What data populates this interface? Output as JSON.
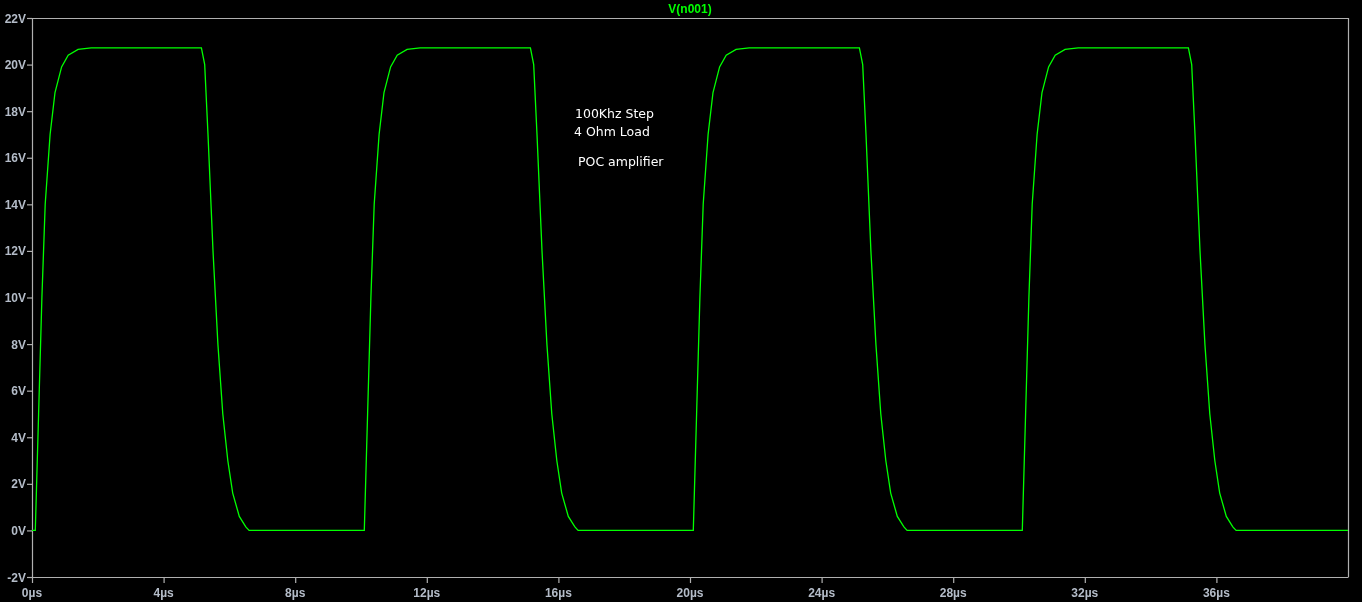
{
  "plot": {
    "chart_data": {
      "type": "line",
      "x": [
        0,
        0.1,
        0.2,
        0.3,
        0.4,
        0.55,
        0.7,
        0.9,
        1.1,
        1.4,
        1.8,
        5.15,
        5.25,
        5.35,
        5.5,
        5.65,
        5.8,
        5.95,
        6.1,
        6.3,
        6.5,
        6.6,
        10.1,
        10.2,
        10.3,
        10.4,
        10.55,
        10.7,
        10.9,
        11.1,
        11.4,
        11.8,
        15.15,
        15.25,
        15.35,
        15.5,
        15.65,
        15.8,
        15.95,
        16.1,
        16.3,
        16.5,
        16.6,
        20.1,
        20.2,
        20.3,
        20.4,
        20.55,
        20.7,
        20.9,
        21.1,
        21.4,
        21.8,
        25.15,
        25.25,
        25.35,
        25.5,
        25.65,
        25.8,
        25.95,
        26.1,
        26.3,
        26.5,
        26.6,
        30.1,
        30.2,
        30.3,
        30.4,
        30.55,
        30.7,
        30.9,
        31.1,
        31.4,
        31.8,
        35.15,
        35.25,
        35.35,
        35.5,
        35.65,
        35.8,
        35.95,
        36.1,
        36.3,
        36.5,
        36.6,
        40
      ],
      "series": [
        {
          "name": "V(n001)",
          "color": "#00ff00",
          "values": [
            0,
            0,
            5,
            10,
            14,
            17,
            18.8,
            19.9,
            20.4,
            20.65,
            20.72,
            20.72,
            20,
            17,
            12,
            8,
            5,
            3,
            1.6,
            0.6,
            0.15,
            0,
            0,
            5,
            10,
            14,
            17,
            18.8,
            19.9,
            20.4,
            20.65,
            20.72,
            20.72,
            20,
            17,
            12,
            8,
            5,
            3,
            1.6,
            0.6,
            0.15,
            0,
            0,
            5,
            10,
            14,
            17,
            18.8,
            19.9,
            20.4,
            20.65,
            20.72,
            20.72,
            20,
            17,
            12,
            8,
            5,
            3,
            1.6,
            0.6,
            0.15,
            0,
            0,
            5,
            10,
            14,
            17,
            18.8,
            19.9,
            20.4,
            20.65,
            20.72,
            20.72,
            20,
            17,
            12,
            8,
            5,
            3,
            1.6,
            0.6,
            0.15,
            0,
            0
          ]
        }
      ],
      "xlim": [
        0,
        40
      ],
      "ylim": [
        -2,
        22
      ],
      "xticks": [
        {
          "value": 0,
          "label": "0µs"
        },
        {
          "value": 4,
          "label": "4µs"
        },
        {
          "value": 8,
          "label": "8µs"
        },
        {
          "value": 12,
          "label": "12µs"
        },
        {
          "value": 16,
          "label": "16µs"
        },
        {
          "value": 20,
          "label": "20µs"
        },
        {
          "value": 24,
          "label": "24µs"
        },
        {
          "value": 28,
          "label": "28µs"
        },
        {
          "value": 32,
          "label": "32µs"
        },
        {
          "value": 36,
          "label": "36µs"
        }
      ],
      "yticks": [
        {
          "value": -2,
          "label": "-2V"
        },
        {
          "value": 0,
          "label": "0V"
        },
        {
          "value": 2,
          "label": "2V"
        },
        {
          "value": 4,
          "label": "4V"
        },
        {
          "value": 6,
          "label": "6V"
        },
        {
          "value": 8,
          "label": "8V"
        },
        {
          "value": 10,
          "label": "10V"
        },
        {
          "value": 12,
          "label": "12V"
        },
        {
          "value": 14,
          "label": "14V"
        },
        {
          "value": 16,
          "label": "16V"
        },
        {
          "value": 18,
          "label": "18V"
        },
        {
          "value": 20,
          "label": "20V"
        },
        {
          "value": 22,
          "label": "22V"
        }
      ],
      "annotations": [
        "100Khz Step",
        "4 Ohm Load",
        "POC amplifier"
      ]
    }
  }
}
